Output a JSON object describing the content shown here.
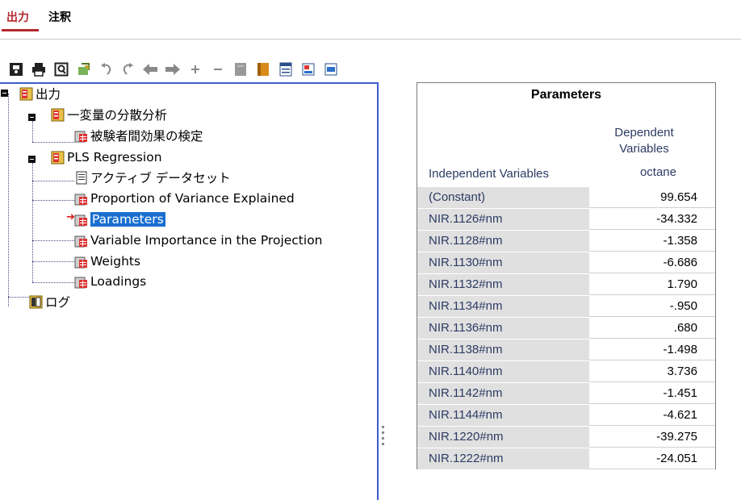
{
  "tabs": [
    {
      "label": "出力",
      "active": true
    },
    {
      "label": "注釈",
      "active": false
    }
  ],
  "toolbar": {
    "icons": [
      "save-icon",
      "print-icon",
      "print-preview-icon",
      "export-icon",
      "undo-icon",
      "redo-icon",
      "back-icon",
      "forward-icon",
      "expand-icon",
      "collapse-icon",
      "show-icon",
      "hide-icon",
      "insert-heading-icon",
      "insert-title-icon",
      "insert-text-icon"
    ]
  },
  "tree": {
    "root": "出力",
    "anova": "一変量の分散分析",
    "anova_child": "被験者間効果の検定",
    "pls": "PLS Regression",
    "active_dataset": "アクティブ データセット",
    "proportion": "Proportion of Variance Explained",
    "parameters": "Parameters",
    "vip": "Variable Importance in the Projection",
    "weights": "Weights",
    "loadings": "Loadings",
    "log": "ログ"
  },
  "table": {
    "title": "Parameters",
    "dep_header_line1": "Dependent",
    "dep_header_line2": "Variables",
    "indep_header": "Independent Variables",
    "dep_var": "octane",
    "rows": [
      {
        "label": "(Constant)",
        "value": "99.654"
      },
      {
        "label": "NIR.1126#nm",
        "value": "-34.332"
      },
      {
        "label": "NIR.1128#nm",
        "value": "-1.358"
      },
      {
        "label": "NIR.1130#nm",
        "value": "-6.686"
      },
      {
        "label": "NIR.1132#nm",
        "value": "1.790"
      },
      {
        "label": "NIR.1134#nm",
        "value": "-.950"
      },
      {
        "label": "NIR.1136#nm",
        "value": ".680"
      },
      {
        "label": "NIR.1138#nm",
        "value": "-1.498"
      },
      {
        "label": "NIR.1140#nm",
        "value": "3.736"
      },
      {
        "label": "NIR.1142#nm",
        "value": "-1.451"
      },
      {
        "label": "NIR.1144#nm",
        "value": "-4.621"
      },
      {
        "label": "NIR.1220#nm",
        "value": "-39.275"
      },
      {
        "label": "NIR.1222#nm",
        "value": "-24.051"
      }
    ]
  },
  "colors": {
    "accent": "#b4282d",
    "selection": "#1a6fd1",
    "pane_border": "#3a5ec9"
  }
}
